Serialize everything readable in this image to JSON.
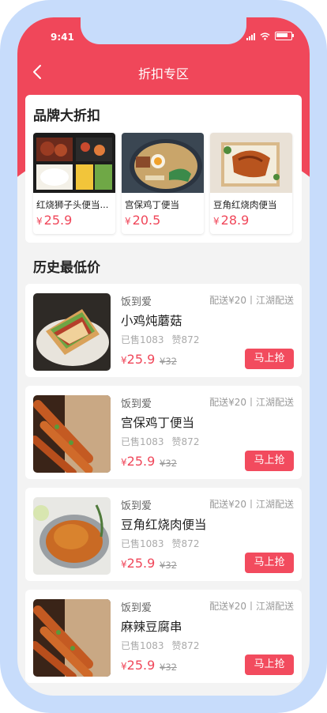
{
  "status_bar": {
    "time": "9:41"
  },
  "nav": {
    "title": "折扣专区"
  },
  "brand_section": {
    "title": "品牌大折扣",
    "items": [
      {
        "name": "红烧狮子头便当...",
        "price": "25.9",
        "currency": "¥"
      },
      {
        "name": "宫保鸡丁便当",
        "price": "20.5",
        "currency": "¥"
      },
      {
        "name": "豆角红烧肉便当",
        "price": "28.9",
        "currency": "¥"
      }
    ]
  },
  "history_section": {
    "title": "历史最低价",
    "items": [
      {
        "shop": "饭到爱",
        "delivery": "配送¥20丨江湖配送",
        "dish": "小鸡炖蘑菇",
        "sold": "已售1083",
        "likes": "赞872",
        "currency": "¥",
        "price": "25.9",
        "original_price": "¥32",
        "button": "马上抢"
      },
      {
        "shop": "饭到爱",
        "delivery": "配送¥20丨江湖配送",
        "dish": "宫保鸡丁便当",
        "sold": "已售1083",
        "likes": "赞872",
        "currency": "¥",
        "price": "25.9",
        "original_price": "¥32",
        "button": "马上抢"
      },
      {
        "shop": "饭到爱",
        "delivery": "配送¥20丨江湖配送",
        "dish": "豆角红烧肉便当",
        "sold": "已售1083",
        "likes": "赞872",
        "currency": "¥",
        "price": "25.9",
        "original_price": "¥32",
        "button": "马上抢"
      },
      {
        "shop": "饭到爱",
        "delivery": "配送¥20丨江湖配送",
        "dish": "麻辣豆腐串",
        "sold": "已售1083",
        "likes": "赞872",
        "currency": "¥",
        "price": "25.9",
        "original_price": "¥32",
        "button": "马上抢"
      }
    ]
  },
  "colors": {
    "accent": "#f0475a",
    "frame": "#c7dcfb",
    "background": "#f3f3f3"
  }
}
